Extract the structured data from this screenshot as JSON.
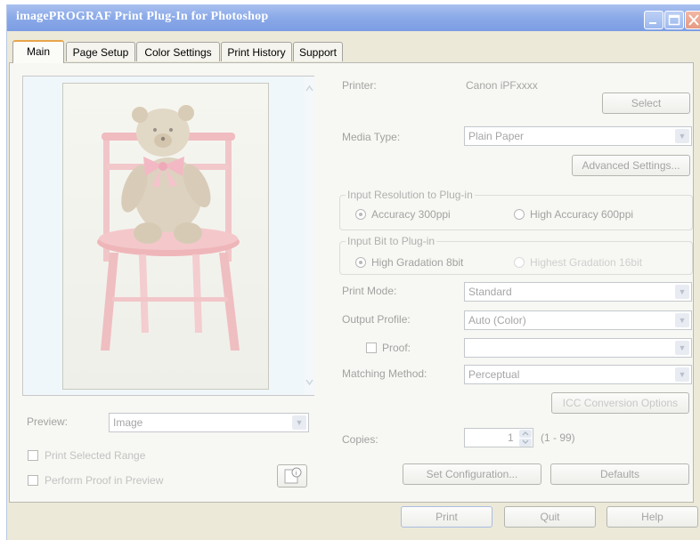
{
  "window": {
    "title": "imagePROGRAF Print Plug-In for Photoshop"
  },
  "tabs": [
    "Main",
    "Page Setup",
    "Color Settings",
    "Print History",
    "Support"
  ],
  "printer": {
    "label": "Printer:",
    "value": "Canon iPFxxxx",
    "select_button": "Select"
  },
  "media_type": {
    "label": "Media Type:",
    "value": "Plain Paper",
    "advanced_button": "Advanced Settings..."
  },
  "input_resolution": {
    "title": "Input Resolution to Plug-in",
    "option1": "Accuracy 300ppi",
    "option2": "High Accuracy 600ppi"
  },
  "input_bit": {
    "title": "Input Bit to Plug-in",
    "option1": "High Gradation 8bit",
    "option2": "Highest Gradation 16bit"
  },
  "print_mode": {
    "label": "Print Mode:",
    "value": "Standard"
  },
  "output_profile": {
    "label": "Output Profile:",
    "value": "Auto (Color)"
  },
  "proof": {
    "label": "Proof:",
    "value": ""
  },
  "matching_method": {
    "label": "Matching Method:",
    "value": "Perceptual"
  },
  "icc_button": "ICC Conversion Options",
  "copies": {
    "label": "Copies:",
    "value": "1",
    "range": "(1 - 99)"
  },
  "set_configuration_button": "Set Configuration...",
  "defaults_button": "Defaults",
  "preview": {
    "label": "Preview:",
    "value": "Image",
    "print_selected_range": "Print Selected Range",
    "perform_proof": "Perform Proof in Preview"
  },
  "footer": {
    "print": "Print",
    "quit": "Quit",
    "help": "Help"
  },
  "colors": {
    "title_bar": "#8aa9e8",
    "tab_accent": "#e8a44a",
    "disabled_text": "#a5a5a5"
  }
}
